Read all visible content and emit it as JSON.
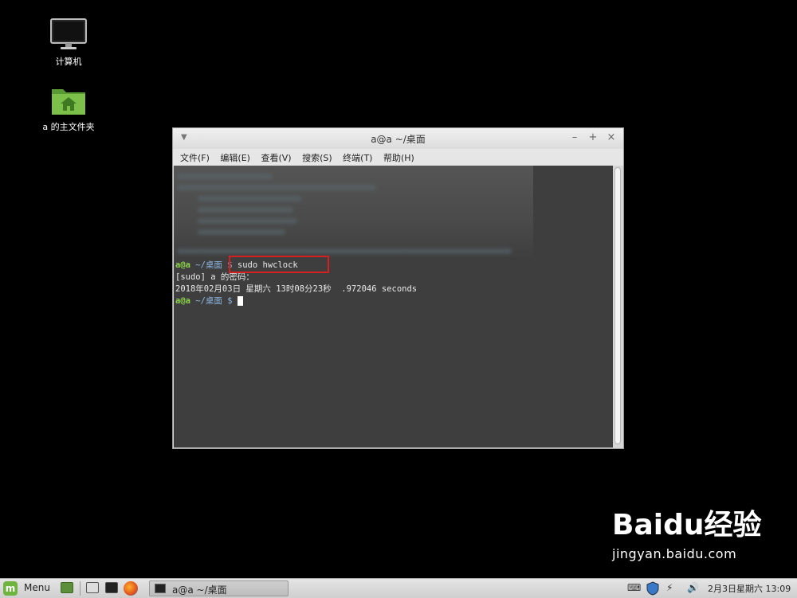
{
  "desktop": {
    "icons": [
      {
        "label": "计算机"
      },
      {
        "label": "a 的主文件夹"
      }
    ]
  },
  "window": {
    "title": "a@a ~/桌面",
    "menu": [
      "文件(F)",
      "编辑(E)",
      "查看(V)",
      "搜索(S)",
      "终端(T)",
      "帮助(H)"
    ],
    "controls": {
      "minimize": "–",
      "maximize": "+",
      "close": "×"
    }
  },
  "terminal": {
    "prompt_user": "a@a",
    "prompt_path": " ~/桌面 $",
    "command": " sudo hwclock",
    "line_sudo": "[sudo] a 的密码：",
    "line_time": "2018年02月03日 星期六 13时08分23秒  .972046 seconds"
  },
  "watermark": {
    "brand_a": "Bai",
    "brand_b": "du",
    "brand_c": "经验",
    "url": "jingyan.baidu.com"
  },
  "taskbar": {
    "menu_label": "Menu",
    "task_label": "a@a ~/桌面",
    "clock": "2月3日星期六 13:09"
  },
  "colors": {
    "prompt_green": "#8ad34a",
    "path_blue": "#8db6e2",
    "highlight_red": "#d62020",
    "mint_green": "#6fb43f"
  }
}
